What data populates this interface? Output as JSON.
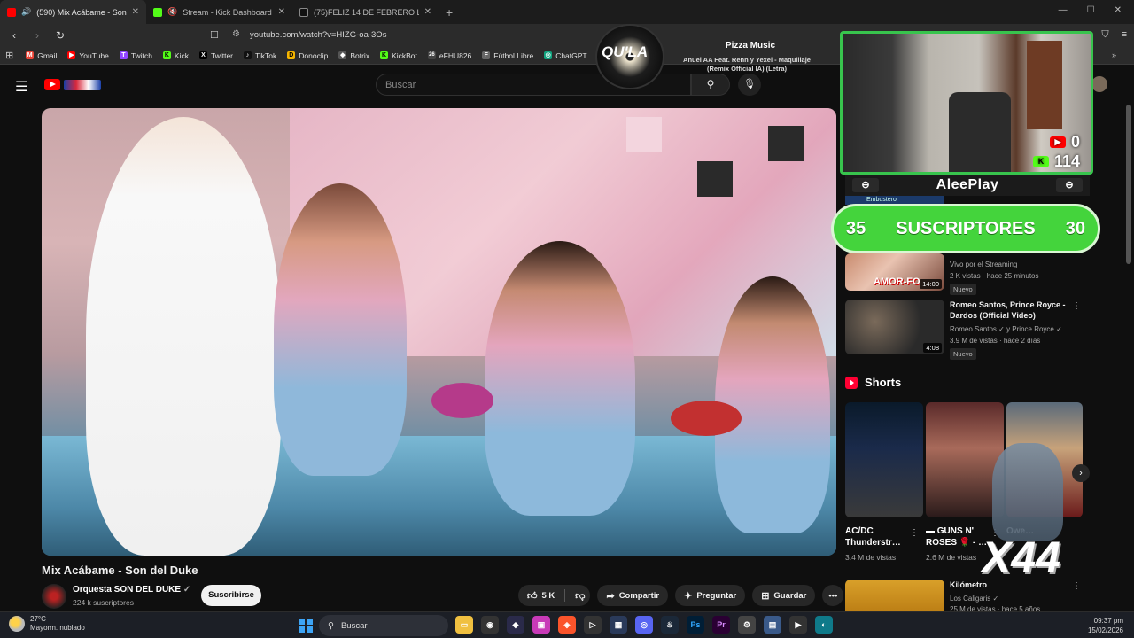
{
  "browser": {
    "tabs": [
      {
        "title": "(590) Mix Acábame - Son del",
        "color": "#ff0000",
        "active": true
      },
      {
        "title": "Stream - Kick Dashboard",
        "color": "#53fc18",
        "active": false
      },
      {
        "title": "(75)FELIZ 14 DE FEBRERO LOKITAS H",
        "color": "#ffffff",
        "active": false
      }
    ],
    "url": "youtube.com/watch?v=HIZG-oa-3Os",
    "bookmarks": [
      {
        "label": "Gmail",
        "color": "#ea4335",
        "glyph": "M"
      },
      {
        "label": "YouTube",
        "color": "#ff0000",
        "glyph": "▶"
      },
      {
        "label": "Twitch",
        "color": "#9146ff",
        "glyph": "T"
      },
      {
        "label": "Kick",
        "color": "#53fc18",
        "glyph": "K"
      },
      {
        "label": "Twitter",
        "color": "#000000",
        "glyph": "X"
      },
      {
        "label": "TikTok",
        "color": "#111111",
        "glyph": "♪"
      },
      {
        "label": "Donoclip",
        "color": "#f4b400",
        "glyph": "D"
      },
      {
        "label": "Botrix",
        "color": "#555555",
        "glyph": "◆"
      },
      {
        "label": "KickBot",
        "color": "#53fc18",
        "glyph": "K"
      },
      {
        "label": "eFHU826",
        "color": "#444444",
        "glyph": "26"
      },
      {
        "label": "Fútbol Libre",
        "color": "#666666",
        "glyph": "F"
      },
      {
        "label": "ChatGPT",
        "color": "#10a37f",
        "glyph": "◎"
      }
    ],
    "bookmarks_more": "Mix N"
  },
  "youtube": {
    "search_placeholder": "Buscar",
    "video": {
      "title": "Mix Acábame - Son del Duke",
      "channel": "Orquesta SON DEL DUKE",
      "subscribers": "224 k suscriptores",
      "subscribe_label": "Suscribirse",
      "likes": "5 K",
      "share_label": "Compartir",
      "ask_label": "Preguntar",
      "save_label": "Guardar"
    },
    "recommendations": [
      {
        "title": "",
        "meta1": "Vivo por el Streaming",
        "meta2": "2 K vistas · hace 25 minutos",
        "duration": "14:00",
        "badge": "Nuevo",
        "thumb_text": "AMOR-FO"
      },
      {
        "title": "Romeo Santos, Prince Royce - Dardos (Official Video)",
        "meta1": "Romeo Santos ✓ y Prince Royce ✓",
        "meta2": "3.9 M de vistas · hace 2 días",
        "duration": "4:08",
        "badge": "Nuevo",
        "thumb_text": ""
      }
    ],
    "shorts_heading": "Shorts",
    "shorts": [
      {
        "title": "AC/DC Thunderstr…",
        "views": "3.4 M de vistas"
      },
      {
        "title": "▬ GUNS N' ROSES 🌹 - …",
        "views": "2.6 M de vistas"
      },
      {
        "title": "Owe…",
        "views": ""
      }
    ],
    "last_rec": {
      "title": "Kilómetro",
      "meta1": "Los Caligaris ✓",
      "meta2": "25 M de vistas · hace 5 años"
    }
  },
  "overlay": {
    "now_playing_label": "Pizza Music",
    "now_playing_track": "Anuel AA Feat. Renn y Yexel - Maquillaje (Remix Official IA) (Letra)",
    "disc_text": "QU'LA",
    "youtube_count": "0",
    "kick_count": "114",
    "streamer_name": "AleePlay",
    "sub_goal_left": "35",
    "sub_goal_label": "SUSCRIPTORES",
    "sub_goal_right": "30",
    "combo": "X44",
    "banner_text": "Embustero"
  },
  "taskbar": {
    "weather_temp": "27°C",
    "weather_desc": "Mayorm. nublado",
    "search_label": "Buscar",
    "time": "09:37 pm",
    "date": "15/02/2026"
  }
}
